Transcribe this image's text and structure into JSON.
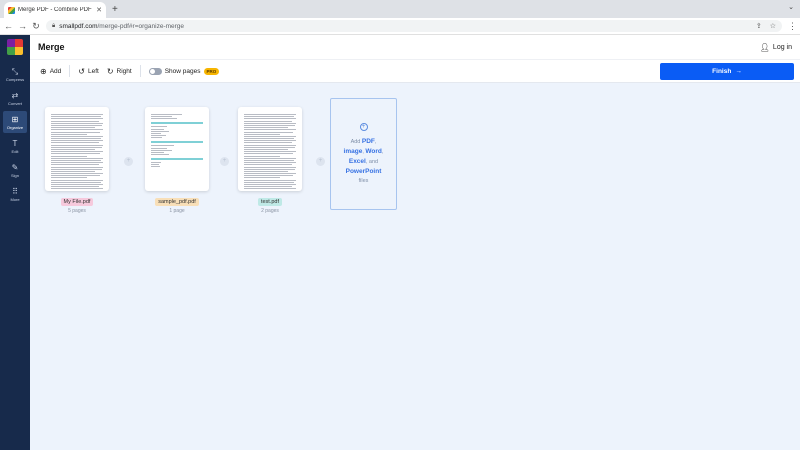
{
  "browser": {
    "tab_title": "Merge PDF - Combine PDF fil",
    "new_tab": "+",
    "url_host": "smallpdf.com",
    "url_path": "/merge-pdf#r=organize-merge"
  },
  "sidebar": {
    "items": [
      {
        "label": "Compress",
        "icon": "compress-icon"
      },
      {
        "label": "Convert",
        "icon": "convert-icon"
      },
      {
        "label": "Organize",
        "icon": "organize-icon"
      },
      {
        "label": "Edit",
        "icon": "edit-icon"
      },
      {
        "label": "Sign",
        "icon": "sign-icon"
      },
      {
        "label": "More",
        "icon": "more-grid-icon"
      }
    ]
  },
  "header": {
    "title": "Merge",
    "login": "Log in"
  },
  "toolbar": {
    "add": "Add",
    "left": "Left",
    "right": "Right",
    "show_pages": "Show pages",
    "pro_badge": "PRO",
    "finish": "Finish"
  },
  "files": [
    {
      "name": "My File.pdf",
      "pages": "5 pages",
      "tag_color": "#f6c9dc"
    },
    {
      "name": "sample_pdf.pdf",
      "pages": "1 page",
      "tag_color": "#f8dfb8"
    },
    {
      "name": "test.pdf",
      "pages": "2 pages",
      "tag_color": "#bfe9e6"
    }
  ],
  "add_box": {
    "prefix": "Add",
    "pdf": "PDF",
    "image": "image",
    "word": "Word",
    "excel": "Excel",
    "and": "and",
    "powerpoint": "PowerPoint",
    "suffix": "files"
  }
}
